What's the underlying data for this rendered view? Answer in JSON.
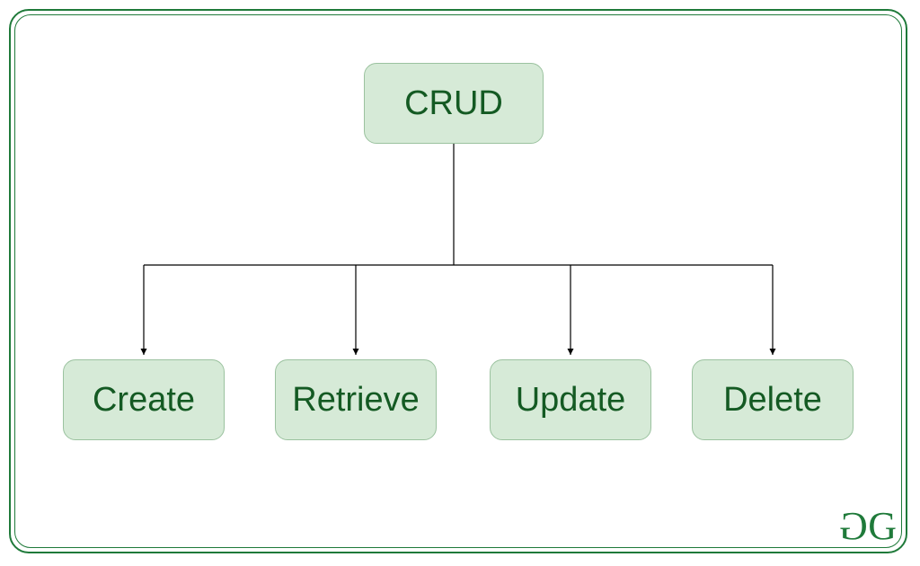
{
  "colors": {
    "border_green": "#1f7a3a",
    "node_fill": "#d6ead7",
    "node_border": "#9bc29f",
    "text_green": "#145a23"
  },
  "root": {
    "label": "CRUD"
  },
  "children": [
    {
      "label": "Create"
    },
    {
      "label": "Retrieve"
    },
    {
      "label": "Update"
    },
    {
      "label": "Delete"
    }
  ],
  "logo": {
    "text": "GG",
    "brand": "GeeksforGeeks"
  }
}
